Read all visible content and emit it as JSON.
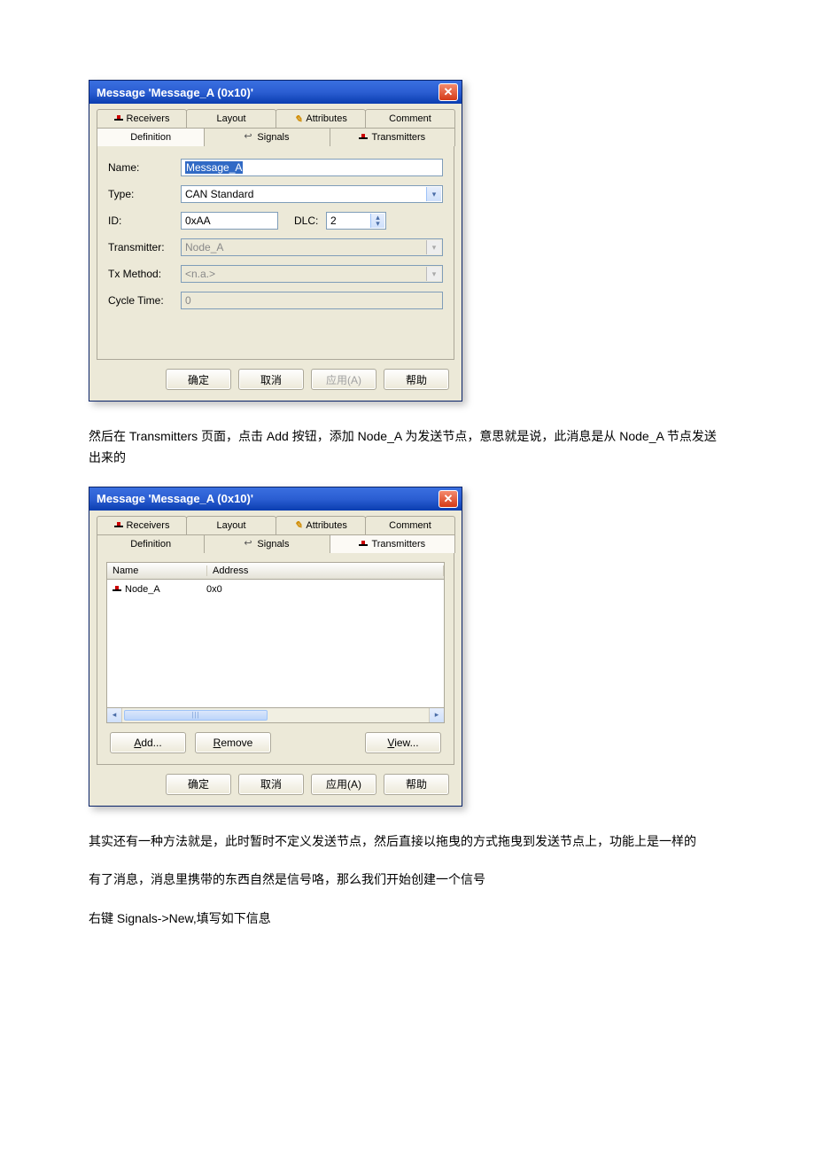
{
  "dialog1": {
    "title": "Message 'Message_A (0x10)'",
    "tabs_row1": {
      "receivers": "Receivers",
      "layout": "Layout",
      "attributes": "Attributes",
      "comment": "Comment"
    },
    "tabs_row2": {
      "definition": "Definition",
      "signals": "Signals",
      "transmitters": "Transmitters"
    },
    "fields": {
      "name_lbl": "Name:",
      "name_val": "Message_A",
      "type_lbl": "Type:",
      "type_val": "CAN Standard",
      "id_lbl": "ID:",
      "id_val": "0xAA",
      "dlc_lbl": "DLC:",
      "dlc_val": "2",
      "trans_lbl": "Transmitter:",
      "trans_val": "Node_A",
      "txm_lbl": "Tx Method:",
      "txm_val": "<n.a.>",
      "cyc_lbl": "Cycle Time:",
      "cyc_val": "0"
    },
    "btns": {
      "ok": "确定",
      "cancel": "取消",
      "apply": "应用(A)",
      "help": "帮助"
    }
  },
  "para1": "然后在 Transmitters 页面，点击 Add 按钮，添加 Node_A 为发送节点，意思就是说，此消息是从 Node_A 节点发送出来的",
  "dialog2": {
    "title": "Message 'Message_A (0x10)'",
    "tabs_row1": {
      "receivers": "Receivers",
      "layout": "Layout",
      "attributes": "Attributes",
      "comment": "Comment"
    },
    "tabs_row2": {
      "definition": "Definition",
      "signals": "Signals",
      "transmitters": "Transmitters"
    },
    "list": {
      "col1": "Name",
      "col2": "Address",
      "row1_name": "Node_A",
      "row1_addr": "0x0"
    },
    "actions": {
      "add": "Add...",
      "remove": "Remove",
      "view": "View..."
    },
    "btns": {
      "ok": "确定",
      "cancel": "取消",
      "apply": "应用(A)",
      "help": "帮助"
    }
  },
  "para2": "其实还有一种方法就是，此时暂时不定义发送节点，然后直接以拖曳的方式拖曳到发送节点上，功能上是一样的",
  "para3": "有了消息，消息里携带的东西自然是信号咯，那么我们开始创建一个信号",
  "para4": "右键 Signals->New,填写如下信息"
}
